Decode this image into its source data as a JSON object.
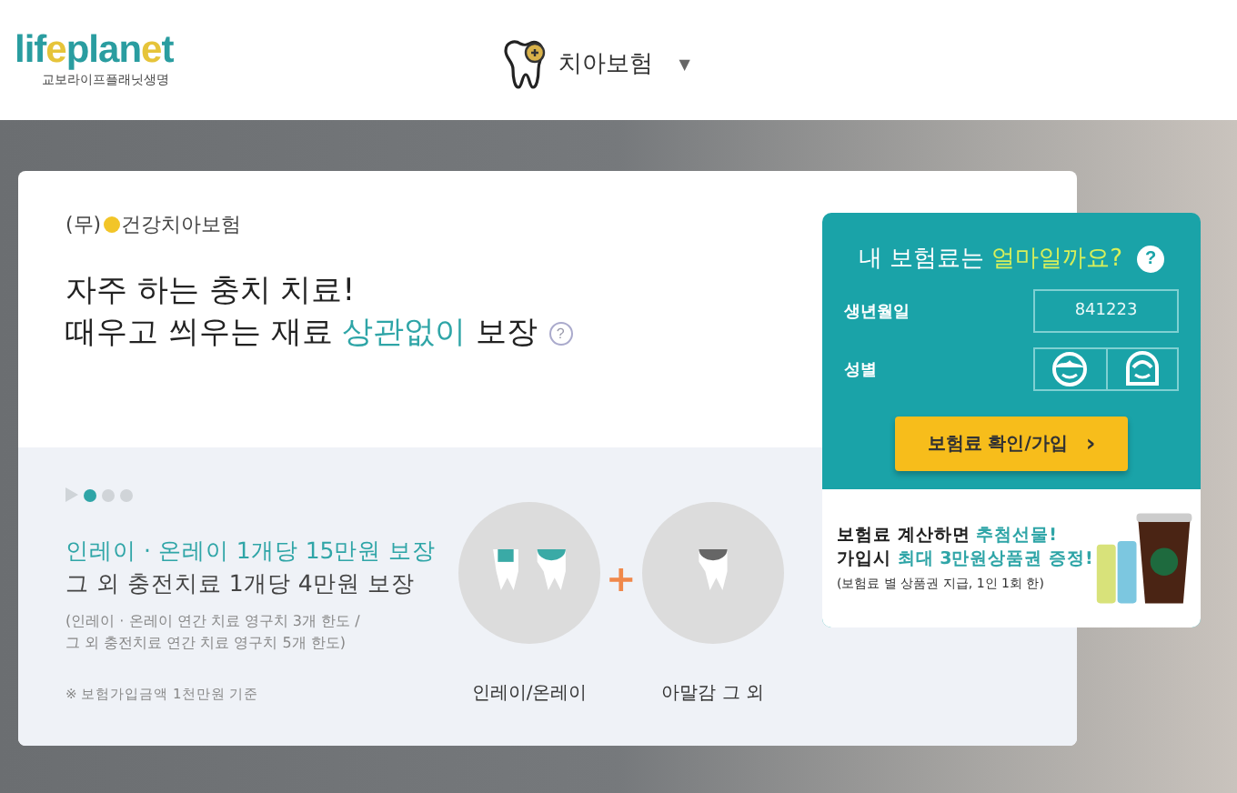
{
  "header": {
    "logo": {
      "word_parts": [
        {
          "text": "lif",
          "accent": false
        },
        {
          "text": "e",
          "accent": true
        },
        {
          "text": "plan",
          "accent": false
        },
        {
          "text": "e",
          "accent": true
        },
        {
          "text": "t",
          "accent": false
        }
      ],
      "subtitle": "교보라이프플래닛생명"
    },
    "product_menu": {
      "label": "치아보험",
      "caret": "▼"
    }
  },
  "product": {
    "prefix": "(무)",
    "name": "건강치아보험",
    "headline": [
      [
        {
          "text": "자주 하는 충치 치료",
          "highlight": false
        },
        {
          "text": "!",
          "highlight": false
        }
      ],
      [
        {
          "text": "때우고 씌우는 재료 ",
          "highlight": false
        },
        {
          "text": "상관없이",
          "highlight": true
        },
        {
          "text": " 보장",
          "highlight": false
        }
      ]
    ],
    "help": "?"
  },
  "carousel": {
    "dots": [
      {
        "selected": true
      },
      {
        "selected": false
      },
      {
        "selected": false
      }
    ]
  },
  "coverage": {
    "lines": [
      {
        "text": "인레이 · 온레이 1개당 15만원 보장",
        "highlight": true
      },
      {
        "text": "그 외 충전치료 1개당 4만원 보장",
        "highlight": false
      }
    ],
    "limits": [
      "(인레이 · 온레이 연간 치료 영구치 3개 한도 /",
      "그 외 충전치료 연간 치료 영구치 5개 한도)"
    ],
    "note": "※ 보험가입금액 1천만원 기준",
    "illustrations": [
      {
        "kind": "inlay",
        "label": "인레이/온레이"
      },
      {
        "kind": "amalgam",
        "label": "아말감 그 외"
      }
    ],
    "plus": "+"
  },
  "quote_panel": {
    "title": [
      {
        "text": "내 보험료는 ",
        "highlight": false
      },
      {
        "text": "얼마일까요?",
        "highlight": true
      }
    ],
    "help": "?",
    "birth_label": "생년월일",
    "birth_placeholder": "841223",
    "gender_label": "성별",
    "genders": [
      {
        "kind": "male",
        "selected": false
      },
      {
        "kind": "female",
        "selected": false
      }
    ],
    "submit": "보험료 확인/가입",
    "submit_arrow": "›",
    "promo": [
      [
        {
          "text": "보험료 계산하면 ",
          "highlight": false
        },
        {
          "text": "추첨선물!",
          "highlight": true
        }
      ],
      [
        {
          "text": "가입시 ",
          "highlight": false
        },
        {
          "text": "최대 3만원상품권 증정!",
          "highlight": true
        }
      ]
    ],
    "promo_note": "(보험료 별 상품권 지급, 1인 1회 한)"
  }
}
